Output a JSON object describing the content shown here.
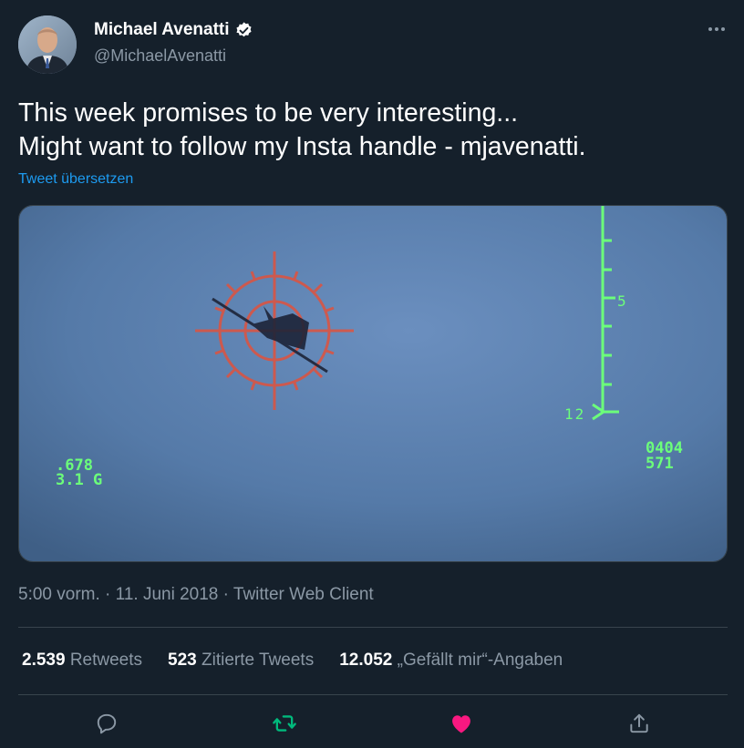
{
  "author": {
    "name": "Michael Avenatti",
    "handle": "@MichaelAvenatti",
    "verified": true
  },
  "tweet": {
    "line1": "This week promises to be very interesting...",
    "line2": "Might want to follow my Insta handle - mjavenatti.",
    "translate_label": "Tweet übersetzen"
  },
  "media": {
    "hud": {
      "scale_label": "5",
      "scale_marker": "12",
      "left_line1": ".678",
      "left_line2": "3.1 G",
      "right_line1": "0404",
      "right_line2": "571"
    }
  },
  "meta": {
    "time": "5:00 vorm.",
    "sep1": "·",
    "date": "11. Juni 2018",
    "sep2": "·",
    "client": "Twitter Web Client"
  },
  "stats": {
    "retweets_count": "2.539",
    "retweets_label": "Retweets",
    "quotes_count": "523",
    "quotes_label": "Zitierte Tweets",
    "likes_count": "12.052",
    "likes_label": "„Gefällt mir“-Angaben"
  },
  "icons": {
    "reply": "reply-icon",
    "retweet": "retweet-icon",
    "like": "heart-icon",
    "share": "share-icon"
  },
  "colors": {
    "background": "#15202b",
    "accent": "#1d9bf0",
    "retweet": "#00ba7c",
    "like": "#f91880",
    "muted": "#8b98a5"
  }
}
